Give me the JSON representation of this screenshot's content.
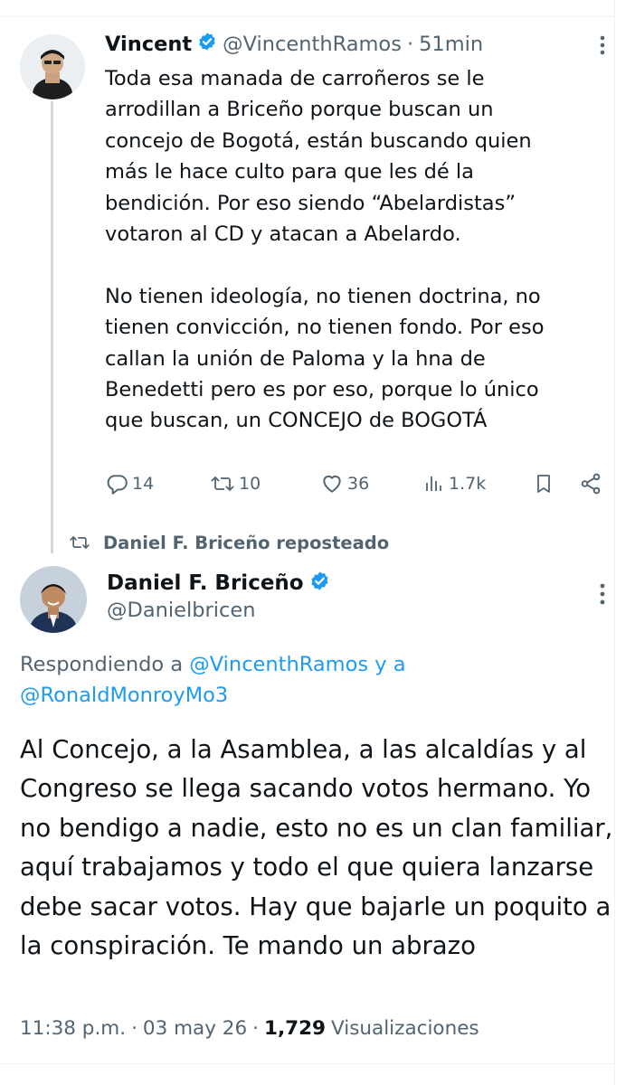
{
  "tweet1": {
    "display_name": "Vincent",
    "handle": "@VincenthRamos",
    "separator": "·",
    "time": "51min",
    "text": "Toda esa manada de carroñeros se le\narrodillan a Briceño porque buscan un\nconcejo de Bogotá, están buscando quien\nmás le hace culto para que les dé la\nbendición. Por eso siendo “Abelardistas”\nvotaron al CD y atacan a Abelardo.\n\nNo tienen ideología, no tienen doctrina, no\ntienen convicción, no tienen fondo. Por eso\ncallan la unión de Paloma y la hna de\nBenedetti pero es por eso, porque lo único\nque buscan, un CONCEJO de BOGOTÁ",
    "replies": "14",
    "reposts": "10",
    "likes": "36",
    "views": "1.7k"
  },
  "repost_banner": {
    "text": "Daniel F. Briceño reposteado"
  },
  "tweet2": {
    "display_name": "Daniel F. Briceño",
    "handle": "@Danielbricen",
    "replying_prefix": "Respondiendo a ",
    "replying_user1": "@VincenthRamos",
    "replying_and": " y a",
    "replying_user2": "@RonaldMonroyMo3",
    "text": "Al Concejo, a la Asamblea, a las alcaldías y al Congreso se llega sacando votos hermano. Yo no bendigo a nadie, esto no es un clan familiar, aquí trabajamos y todo el que quiera lanzarse debe sacar votos. Hay que bajarle un poquito a la conspiración. Te mando un abrazo",
    "time": "11:38 p.m.",
    "date": "03 may 26",
    "dot": "·",
    "views_count": "1,729",
    "views_label": "Visualizaciones"
  },
  "colors": {
    "verified": "#1d9bf0",
    "link": "#1d9bf0",
    "muted": "#536471",
    "text": "#0f1419"
  },
  "icons": [
    "verified-badge-icon",
    "more-icon",
    "reply-icon",
    "repost-icon",
    "like-icon",
    "views-icon",
    "bookmark-icon",
    "share-icon"
  ]
}
